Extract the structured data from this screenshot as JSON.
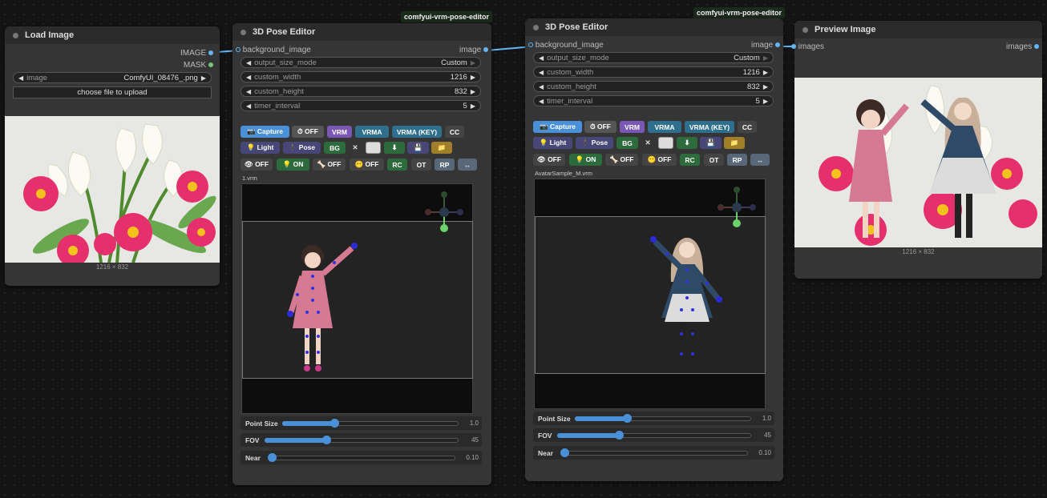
{
  "load_image": {
    "title": "Load Image",
    "outputs": [
      "IMAGE",
      "MASK"
    ],
    "image_widget": {
      "label": "image",
      "value": "ComfyUI_08476_.png"
    },
    "upload_label": "choose file to upload",
    "caption": "1216 × 832"
  },
  "editor1": {
    "badge": "comfyui-vrm-pose-editor",
    "title": "3D Pose Editor",
    "input": "background_image",
    "output": "image",
    "widgets": [
      {
        "label": "output_size_mode",
        "value": "Custom"
      },
      {
        "label": "custom_width",
        "value": "1216"
      },
      {
        "label": "custom_height",
        "value": "832"
      },
      {
        "label": "timer_interval",
        "value": "5"
      }
    ],
    "file": "1.vrm",
    "sliders": [
      {
        "label": "Point Size",
        "value": "1.0"
      },
      {
        "label": "FOV",
        "value": "45"
      },
      {
        "label": "Near",
        "value": "0.10"
      }
    ]
  },
  "editor2": {
    "badge": "comfyui-vrm-pose-editor",
    "title": "3D Pose Editor",
    "input": "background_image",
    "output": "image",
    "widgets": [
      {
        "label": "output_size_mode",
        "value": "Custom"
      },
      {
        "label": "custom_width",
        "value": "1216"
      },
      {
        "label": "custom_height",
        "value": "832"
      },
      {
        "label": "timer_interval",
        "value": "5"
      }
    ],
    "file": "AvatarSample_M.vrm",
    "sliders": [
      {
        "label": "Point Size",
        "value": "1.0"
      },
      {
        "label": "FOV",
        "value": "45"
      },
      {
        "label": "Near",
        "value": "0.10"
      }
    ]
  },
  "toolbar": {
    "row1": {
      "capture": "📷 Capture",
      "off": "⏱ OFF",
      "vrm": "VRM",
      "vrma": "VRMA",
      "vrma_key": "VRMA (KEY)",
      "cc": "CC"
    },
    "row2": {
      "light": "💡 Light",
      "pose": "🕴 Pose",
      "bg": "BG",
      "close": "✕",
      "blank": "",
      "download": "⬇",
      "save": "💾",
      "folder": "📁"
    },
    "row3": {
      "eye": "👁 OFF",
      "bulb": "💡 ON",
      "bone": "🦴 OFF",
      "face": "😶 OFF",
      "rc": "RC",
      "ot": "OT",
      "rp": "RP",
      "swap": "↔"
    }
  },
  "preview": {
    "title": "Preview Image",
    "input": "images",
    "output": "images",
    "caption": "1216 × 832"
  },
  "colors": {
    "accent": "#4a90d9",
    "link": "#64b5f6",
    "node": "#353535",
    "title": "#2b2b2b"
  }
}
